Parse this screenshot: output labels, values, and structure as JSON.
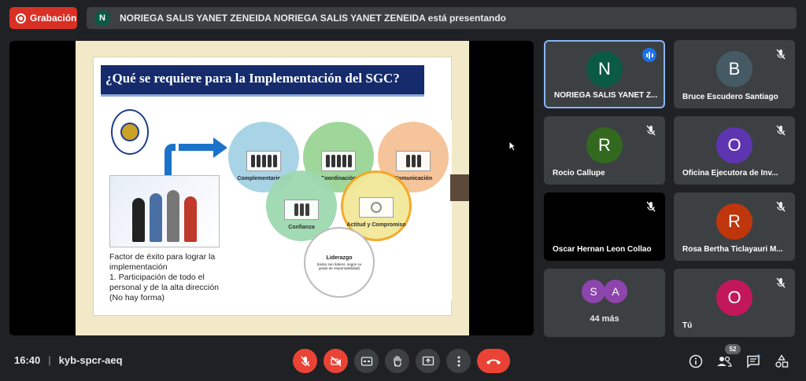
{
  "recording": {
    "label": "Grabación"
  },
  "presenter": {
    "initial": "N",
    "text": "NORIEGA SALIS YANET ZENEIDA NORIEGA SALIS YANET ZENEIDA está presentando"
  },
  "slide": {
    "title": "¿Qué se requiere para la Implementación del SGC?",
    "factor_text": [
      "Factor de éxito para lograr la implementación",
      "1. Participación de todo el personal y de la alta dirección",
      "(No hay forma)"
    ],
    "circles": [
      {
        "label": "Complementariedad",
        "color": "#a9d4e6"
      },
      {
        "label": "Coordinación",
        "color": "#9fd69a"
      },
      {
        "label": "Comunicación",
        "color": "#f6c49a"
      },
      {
        "label": "Confianza",
        "color": "#9ed9b0"
      },
      {
        "label": "Actitud y Compromiso",
        "color": "#f2e89a"
      },
      {
        "label": "Liderazgo",
        "sub": "(todos son líderes, según su grado de responsabilidad)",
        "color": "#ffffff"
      }
    ]
  },
  "participants": [
    {
      "initial": "N",
      "name": "NORIEGA SALIS YANET Z...",
      "color": "#0b5a45",
      "speaking": true
    },
    {
      "initial": "B",
      "name": "Bruce Escudero Santiago",
      "color": "#455a64",
      "muted": true
    },
    {
      "initial": "R",
      "name": "Rocio Callupe",
      "color": "#33691e",
      "muted": true
    },
    {
      "initial": "O",
      "name": "Oficina Ejecutora de Inv...",
      "color": "#5e35b1",
      "muted": true
    },
    {
      "initial": "",
      "name": "Oscar Hernan Leon Collao",
      "color": "#000000",
      "muted": true
    },
    {
      "initial": "R",
      "name": "Rosa Bertha Ticlayauri M...",
      "color": "#bf360c",
      "muted": true
    },
    {
      "more": [
        "S",
        "A"
      ],
      "more_label": "44 más"
    },
    {
      "initial": "O",
      "name": "Tú",
      "color": "#c2185b",
      "muted": true
    }
  ],
  "meeting": {
    "time": "16:40",
    "separator": "|",
    "code": "kyb-spcr-aeq",
    "people_count": "52"
  },
  "colors": {
    "accent": "#8ab4f8",
    "danger": "#ea4335",
    "tile": "#3c4043"
  }
}
